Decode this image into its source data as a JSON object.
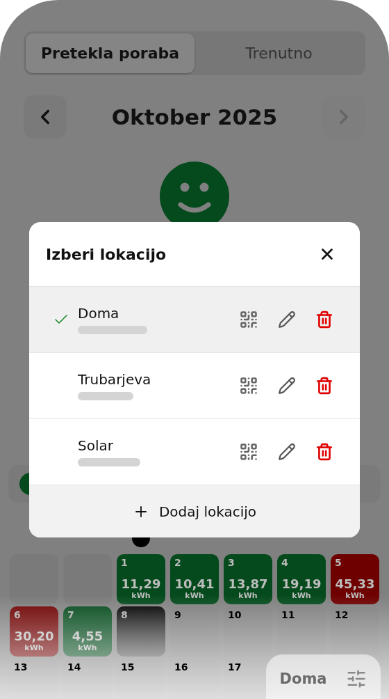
{
  "tabs": [
    {
      "label": "Pretekla poraba",
      "selected": true
    },
    {
      "label": "Trenutno",
      "selected": false
    }
  ],
  "month_nav": {
    "title": "Oktober 2025",
    "next_disabled": true
  },
  "today_marker": {
    "visible": true
  },
  "days": [
    {
      "kind": "empty"
    },
    {
      "kind": "empty"
    },
    {
      "kind": "good",
      "day": "1",
      "value": "11,29",
      "unit": "kWh"
    },
    {
      "kind": "good",
      "day": "2",
      "value": "10,41",
      "unit": "kWh"
    },
    {
      "kind": "good",
      "day": "3",
      "value": "13,87",
      "unit": "kWh"
    },
    {
      "kind": "good",
      "day": "4",
      "value": "19,19",
      "unit": "kWh"
    },
    {
      "kind": "bad",
      "day": "5",
      "value": "45,33",
      "unit": "kWh"
    },
    {
      "kind": "bad",
      "day": "6",
      "value": "30,20",
      "unit": "kWh"
    },
    {
      "kind": "good",
      "day": "7",
      "value": "4,55",
      "unit": "kWh"
    },
    {
      "kind": "today",
      "day": "8"
    },
    {
      "kind": "future",
      "day": "9"
    },
    {
      "kind": "future",
      "day": "10"
    },
    {
      "kind": "future",
      "day": "11"
    },
    {
      "kind": "future",
      "day": "12"
    },
    {
      "kind": "future",
      "day": "13"
    },
    {
      "kind": "future",
      "day": "14"
    },
    {
      "kind": "future",
      "day": "15"
    },
    {
      "kind": "future",
      "day": "16"
    },
    {
      "kind": "future",
      "day": "17"
    }
  ],
  "location_pill": {
    "label": "Doma"
  },
  "dialog": {
    "title": "Izberi lokacijo",
    "locations": [
      {
        "name": "Doma",
        "selected": true
      },
      {
        "name": "Trubarjeva",
        "selected": false
      },
      {
        "name": "Solar",
        "selected": false
      }
    ],
    "add_label": "Dodaj lokacijo"
  }
}
